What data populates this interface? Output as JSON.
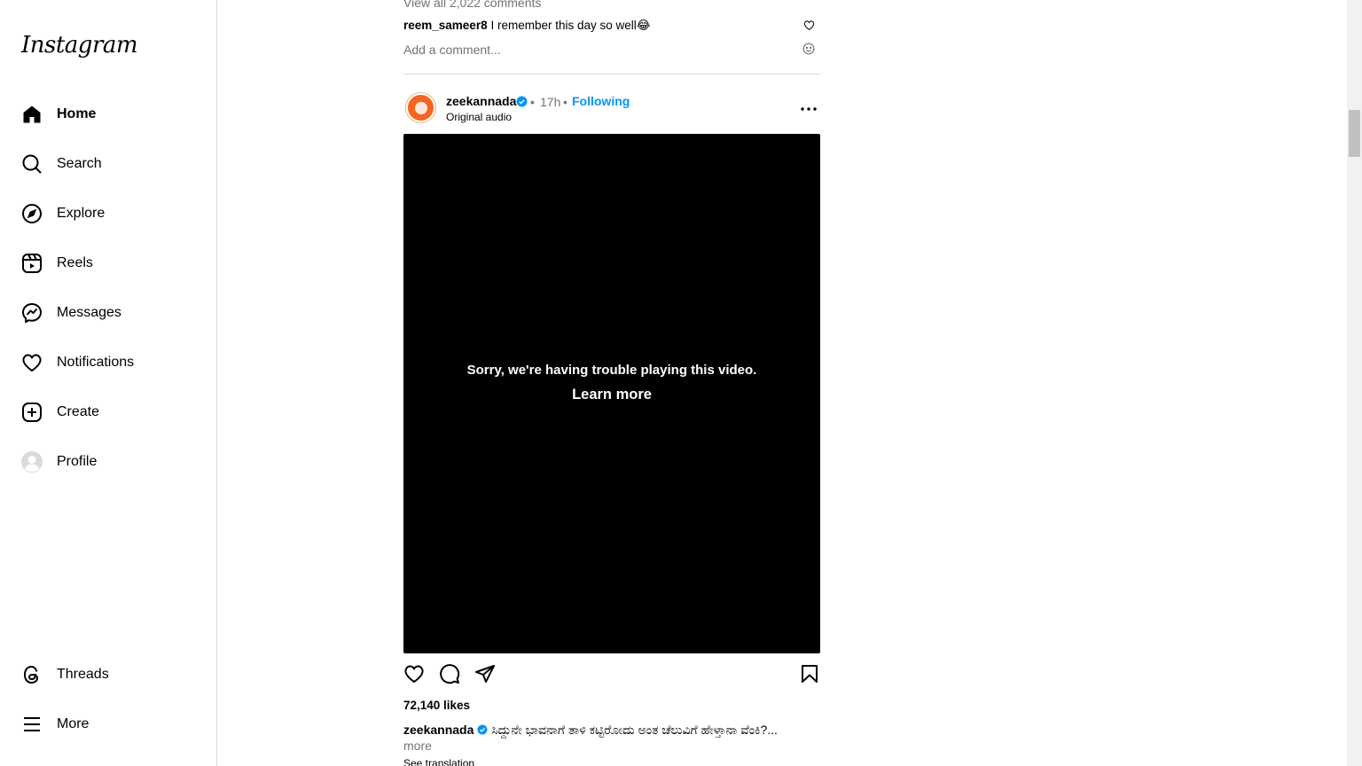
{
  "brand": {
    "logo_text": "Instagram"
  },
  "sidebar": {
    "items": [
      {
        "label": "Home",
        "icon": "home-icon",
        "active": true
      },
      {
        "label": "Search",
        "icon": "search-icon"
      },
      {
        "label": "Explore",
        "icon": "compass-icon"
      },
      {
        "label": "Reels",
        "icon": "reels-icon"
      },
      {
        "label": "Messages",
        "icon": "messenger-icon"
      },
      {
        "label": "Notifications",
        "icon": "heart-icon"
      },
      {
        "label": "Create",
        "icon": "plus-square-icon"
      },
      {
        "label": "Profile",
        "icon": "avatar"
      }
    ],
    "bottom": [
      {
        "label": "Threads",
        "icon": "threads-icon"
      },
      {
        "label": "More",
        "icon": "hamburger-icon"
      }
    ]
  },
  "prev_post": {
    "view_all_comments": "View all 2,022 comments",
    "comment": {
      "user": "reem_sameer8",
      "text": "I remember this day so well😂"
    },
    "add_comment_placeholder": "Add a comment..."
  },
  "post": {
    "user": "zeekannada",
    "sep": "•",
    "time": "17h",
    "follow_status": "Following",
    "audio": "Original audio",
    "video_error": "Sorry, we're having trouble playing this video.",
    "learn_more": "Learn more",
    "likes": "72,140 likes",
    "caption_user": "zeekannada",
    "caption_text": "ಸಿದ್ದುನೇ ಭಾವನಾಗೆ ತಾಳಿ ಕಟ್ಟಿರೋದು ಅಂತ ಚೆಲುವಿಗೆ ಹೇಳ್ತಾನಾ ವೆಂಕಿ?...",
    "caption_more": "more",
    "see_translation": "See translation"
  },
  "colors": {
    "link_blue": "#0095f6",
    "muted": "#737373",
    "border": "#dbdbdb",
    "avatar_orange": "#f26522"
  }
}
